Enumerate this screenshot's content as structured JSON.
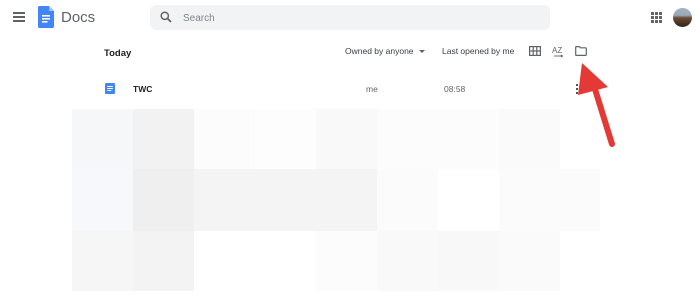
{
  "header": {
    "app_name": "Docs",
    "search_placeholder": "Search",
    "icons": [
      "hamburger-menu-icon",
      "docs-logo-icon",
      "search-icon",
      "apps-grid-icon",
      "avatar"
    ]
  },
  "toolbar": {
    "section_label": "Today",
    "owner_filter": "Owned by anyone",
    "sort_label": "Last opened by me",
    "az_label": "AZ",
    "icons": [
      "list-grid-icon",
      "sort-az-icon",
      "folder-icon"
    ]
  },
  "files": [
    {
      "name": "TWC",
      "owner": "me",
      "last_opened": "08:58",
      "icon": "doc-file-icon"
    }
  ],
  "annotation": {
    "color": "#e53935",
    "icon": "red-arrow-annotation"
  },
  "colors": {
    "docs_blue": "#4285f4",
    "search_bg": "#f1f3f4",
    "text_primary": "#202124",
    "text_secondary": "#5f6368"
  }
}
